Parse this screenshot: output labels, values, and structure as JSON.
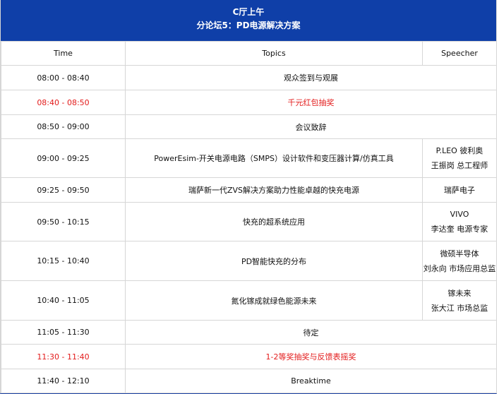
{
  "header": {
    "hall": "C厅上午",
    "forum": "分论坛5：PD电源解决方案"
  },
  "columns": {
    "time": "Time",
    "topics": "Topics",
    "speecher": "Speecher"
  },
  "rows": [
    {
      "time": "08:00 - 08:40",
      "topic": "观众签到与观展",
      "speaker": []
    },
    {
      "time": "08:40 - 08:50",
      "topic": "千元红包抽奖",
      "speaker": []
    },
    {
      "time": "08:50 - 09:00",
      "topic": "会议致辞",
      "speaker": []
    },
    {
      "time": "09:00 - 09:25",
      "topic": "PowerEsim-开关电源电路（SMPS）设计软件和变压器计算/仿真工具",
      "speaker": [
        "P.LEO 彼利奥",
        "王振岗 总工程师"
      ]
    },
    {
      "time": "09:25 - 09:50",
      "topic": "瑞萨新一代ZVS解决方案助力性能卓越的快充电源",
      "speaker": [
        "瑞萨电子"
      ]
    },
    {
      "time": "09:50 - 10:15",
      "topic": "快充的超系统应用",
      "speaker": [
        "VIVO",
        "李达奎 电源专家"
      ]
    },
    {
      "time": "10:15 - 10:40",
      "topic": "PD智能快充的分布",
      "speaker": [
        "微硕半导体",
        "刘永向 市场应用总监"
      ]
    },
    {
      "time": "10:40 - 11:05",
      "topic": "氮化镓成就绿色能源未来",
      "speaker": [
        "镓未来",
        "张大江 市场总监"
      ]
    },
    {
      "time": "11:05 - 11:30",
      "topic": "待定",
      "speaker": []
    },
    {
      "time": "11:30 - 11:40",
      "topic": "1-2等奖抽奖与反馈表摇奖",
      "speaker": []
    },
    {
      "time": "11:40 - 12:10",
      "topic": "Breaktime",
      "speaker": []
    }
  ],
  "colors": {
    "header_bg": "#0f3fa8",
    "highlight": "#e31b1b"
  }
}
